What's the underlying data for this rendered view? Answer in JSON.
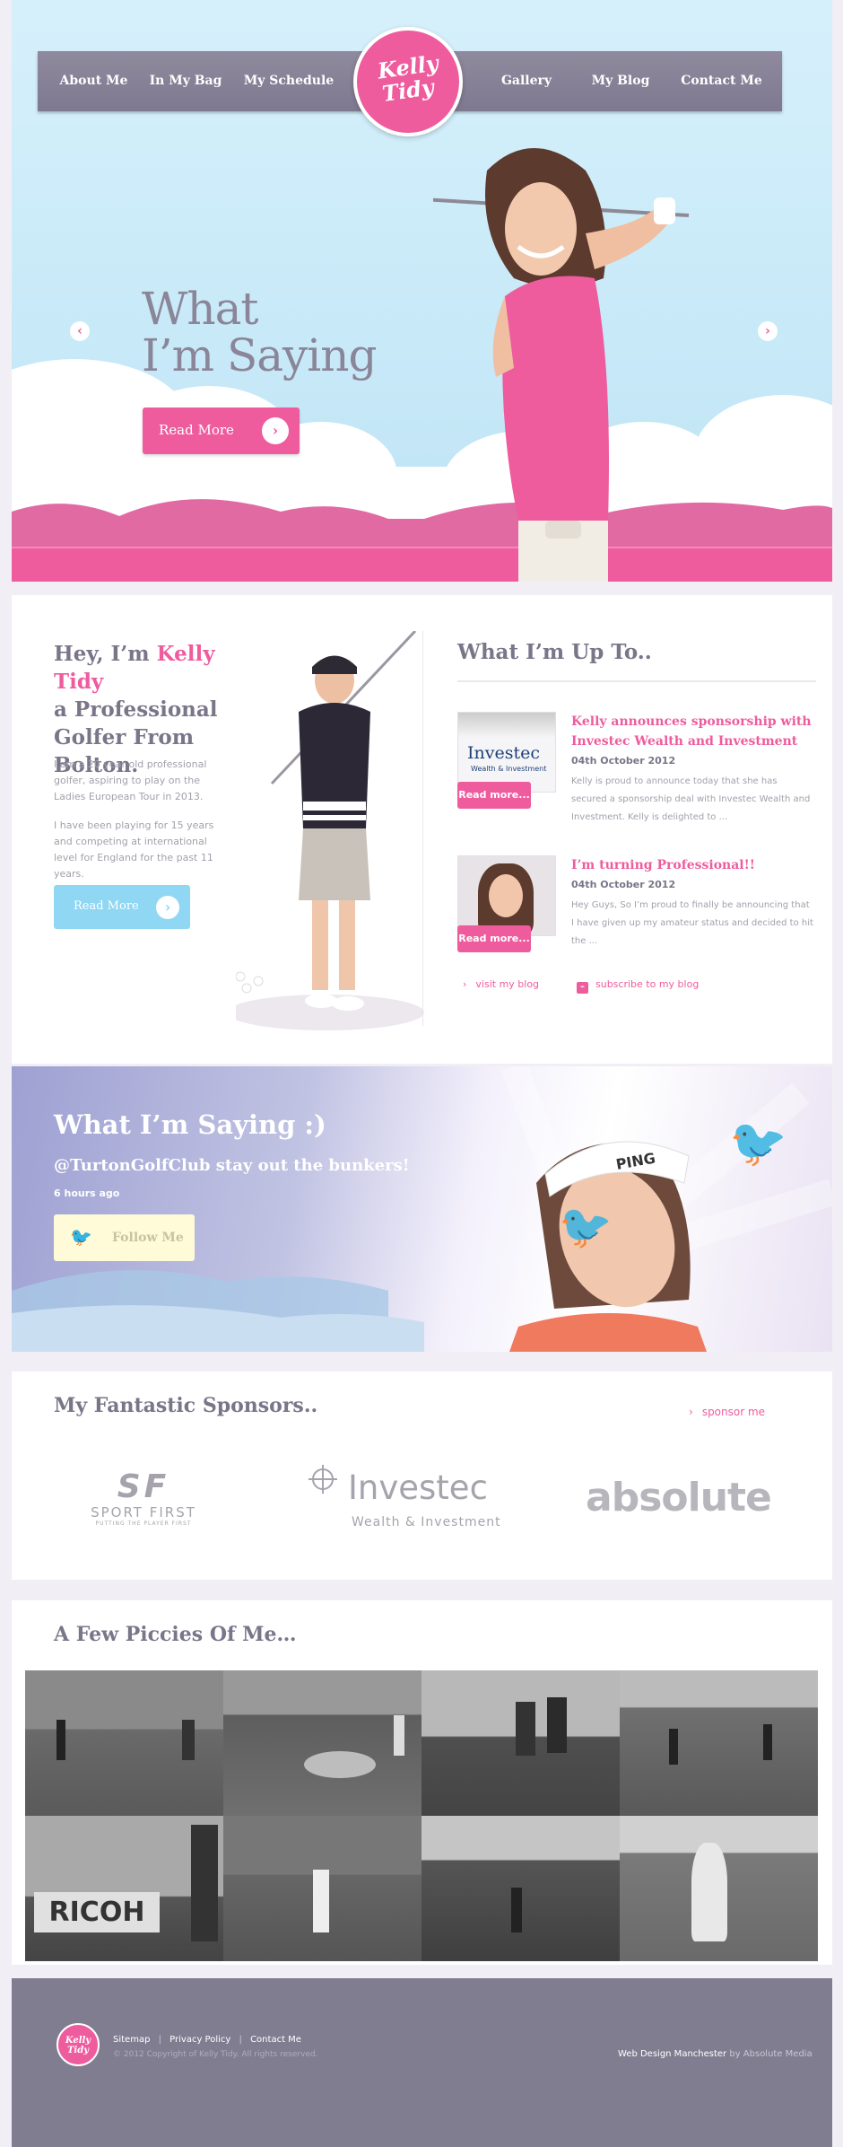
{
  "nav": {
    "left": [
      "About Me",
      "In My Bag",
      "My Schedule"
    ],
    "right": [
      "Gallery",
      "My Blog",
      "Contact Me"
    ],
    "logo_line1": "Kelly",
    "logo_line2": "Tidy"
  },
  "hero": {
    "title_line1": "What",
    "title_line2": "I’m Saying",
    "button": "Read More",
    "prev_arrow": "‹",
    "next_arrow": "›"
  },
  "about": {
    "heading_pre": "Hey, I’m ",
    "heading_name": "Kelly Tidy",
    "heading_rest1": "a Professional",
    "heading_rest2": "Golfer From",
    "heading_rest3": "Bolton.",
    "para1": "I am a 20 year old professional golfer, aspiring to play on the Ladies European Tour in 2013.",
    "para2": "I have been playing for 15 years and competing at international level for England for the past 11 years.",
    "button": "Read More"
  },
  "news": {
    "heading": "What I’m Up To..",
    "items": [
      {
        "title": "Kelly announces sponsorship with Investec Wealth and Investment",
        "date": "04th October 2012",
        "excerpt": "Kelly is proud to announce today that she has secured a sponsorship deal with Investec Wealth and Investment. Kelly is delighted to ...",
        "read": "Read more...",
        "thumb_text": "Investec",
        "thumb_sub": "Wealth & Investment"
      },
      {
        "title": "I’m turning Professional!!",
        "date": "04th October 2012",
        "excerpt": "Hey Guys, So I’m proud to finally be announcing that I have given up my amateur status and decided to hit the ...",
        "read": "Read more..."
      }
    ],
    "visit": "visit my blog",
    "subscribe": "subscribe to my blog"
  },
  "twitter": {
    "heading": "What I’m Saying :)",
    "tweet": "@TurtonGolfClub stay out the bunkers!",
    "time": "6 hours ago",
    "follow": "Follow Me"
  },
  "sponsors": {
    "heading": "My Fantastic Sponsors..",
    "link": "sponsor me",
    "sf_logo": "SF",
    "sf_name": "SPORT FIRST",
    "sf_tag": "PUTTING THE PLAYER FIRST",
    "inv_name": "Investec",
    "inv_sub": "Wealth & Investment",
    "abs_name": "absolute"
  },
  "gallery": {
    "heading": "A Few Piccies Of Me…",
    "ricoh": "RICOH"
  },
  "footer": {
    "logo_line1": "Kelly",
    "logo_line2": "Tidy",
    "links": [
      "Sitemap",
      "Privacy Policy",
      "Contact Me"
    ],
    "copyright": "© 2012 Copyright of Kelly Tidy. All rights reserved.",
    "credit_bold": "Web Design Manchester",
    "credit_rest": " by Absolute Media"
  },
  "colors": {
    "pink": "#ee5c9e",
    "grey_purple": "#817d91",
    "sky": "#c7e9f8",
    "cyan_button": "#8fd7f3"
  }
}
